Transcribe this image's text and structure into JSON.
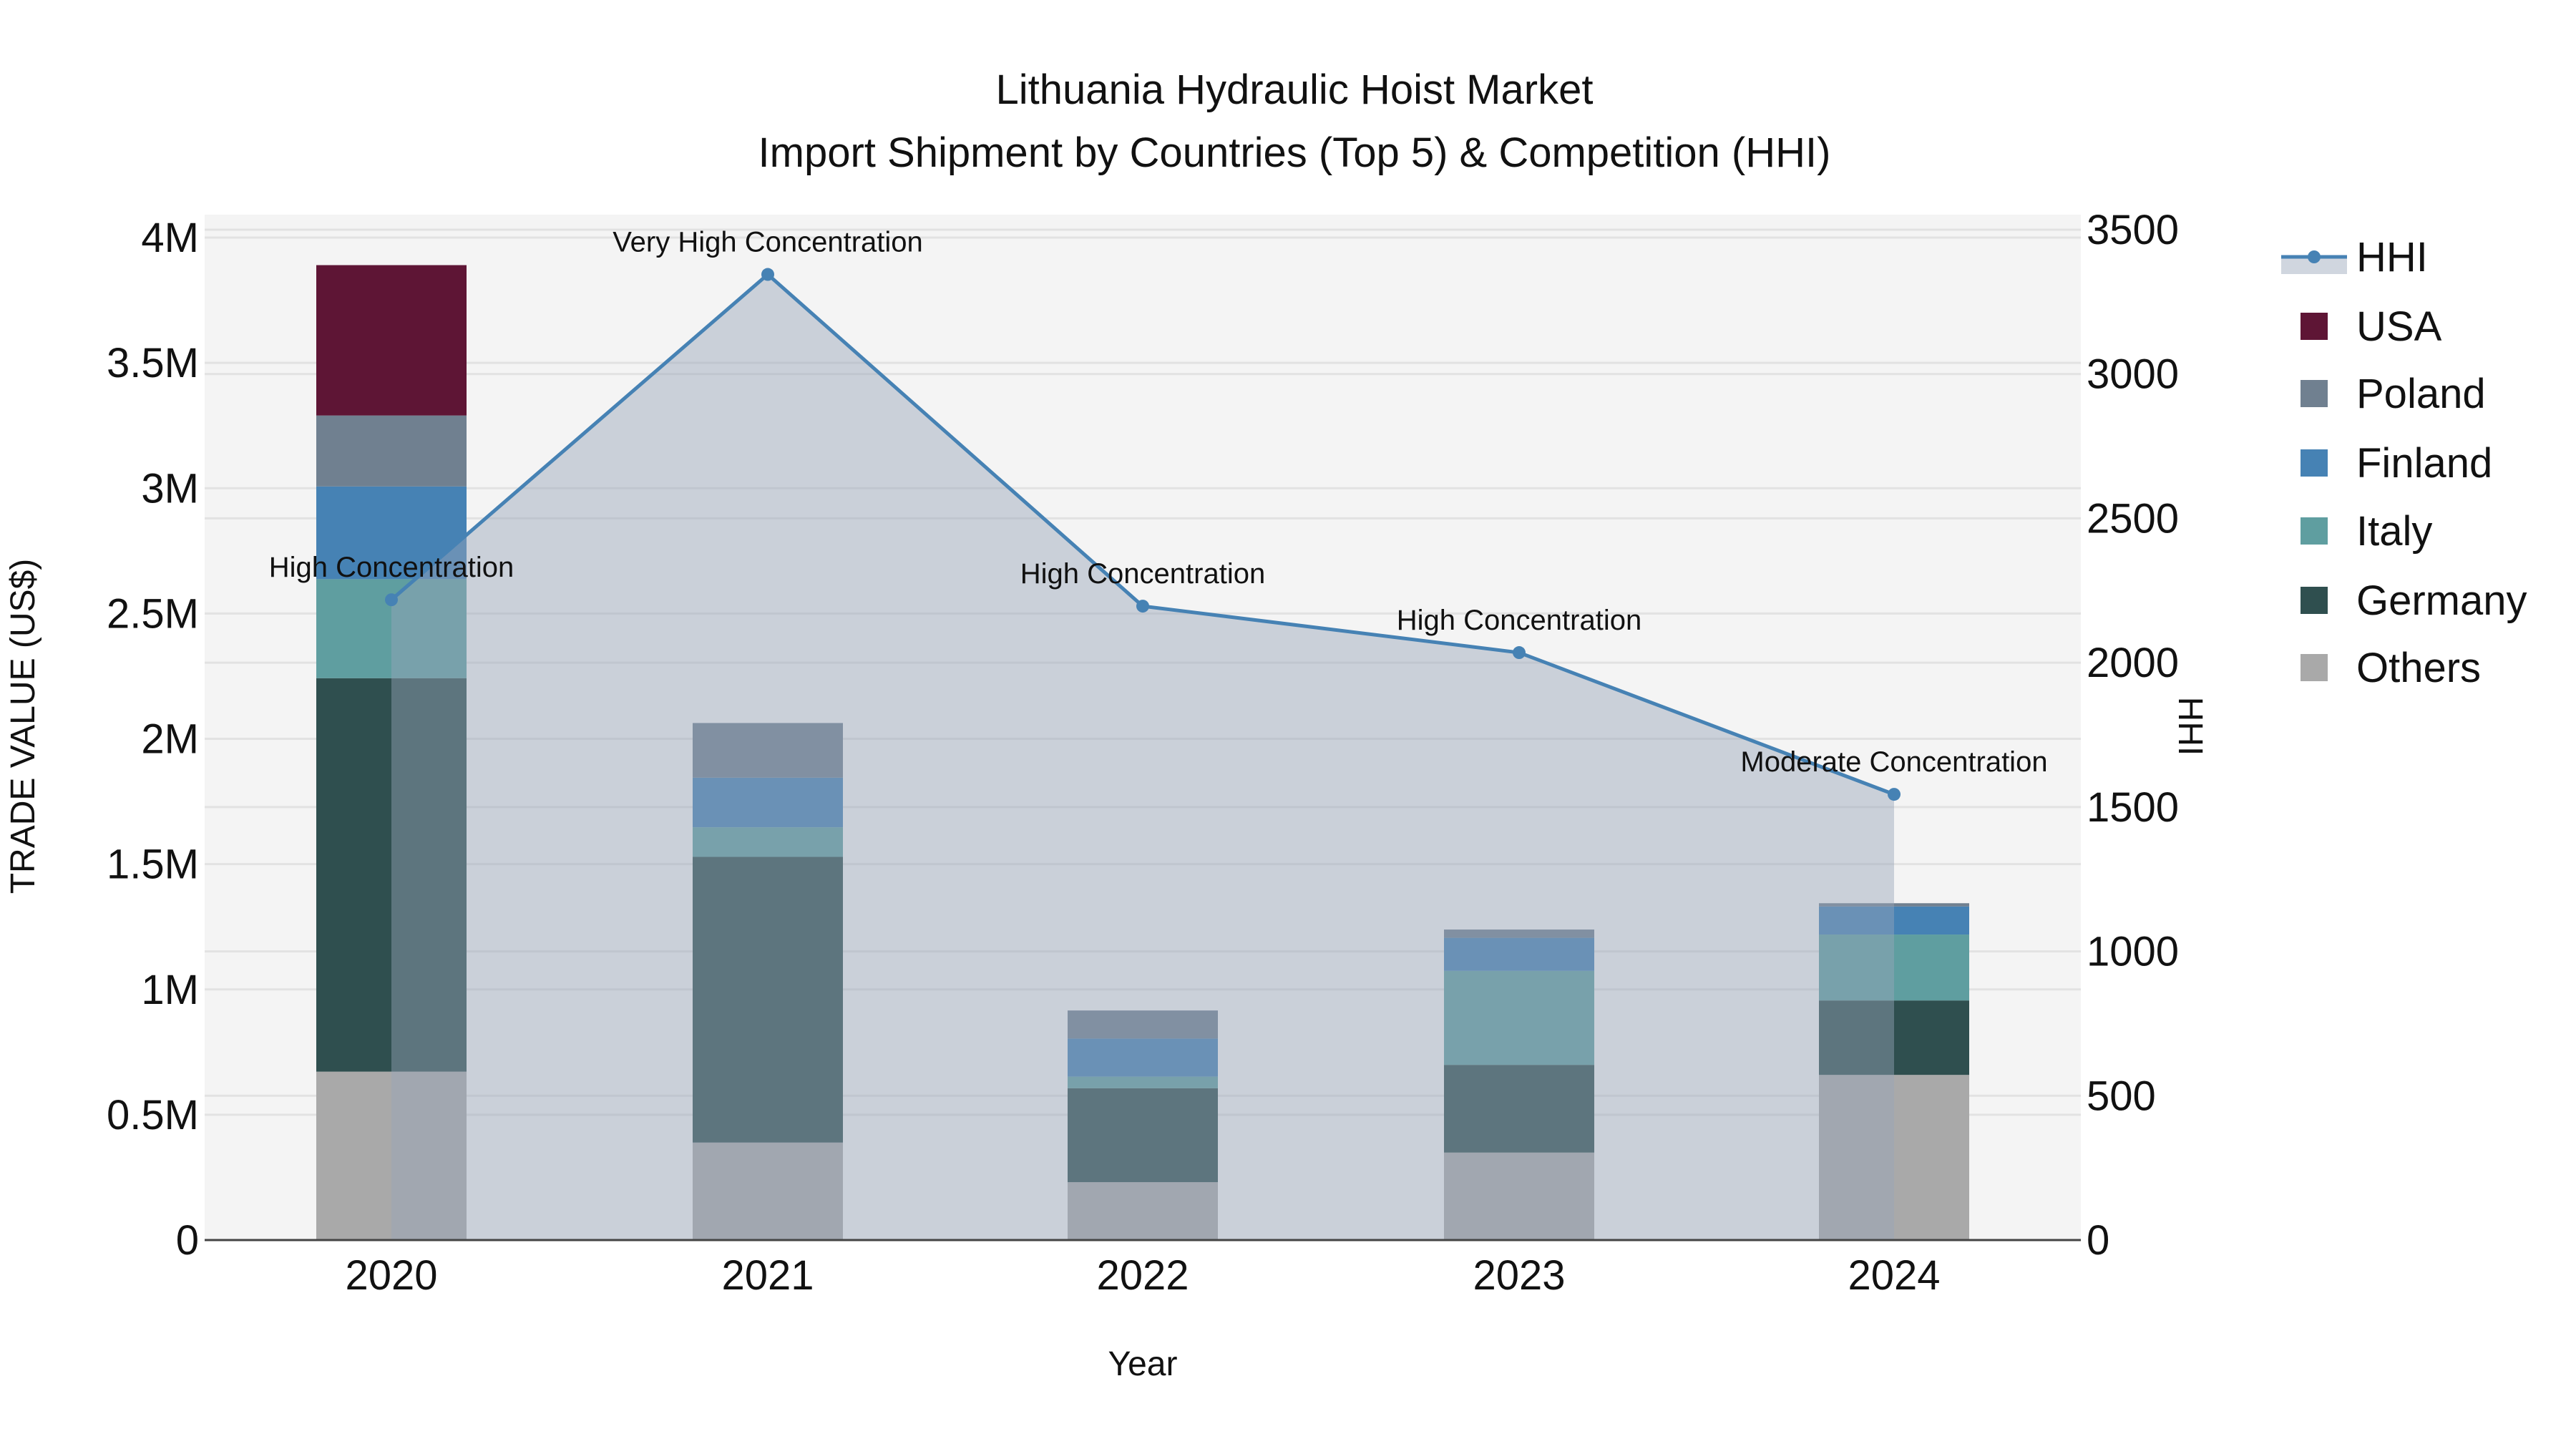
{
  "chart_data": {
    "type": "bar",
    "title": "Lithuania Hydraulic Hoist Market",
    "subtitle": "Import Shipment by Countries (Top 5) & Competition (HHI)",
    "xlabel": "Year",
    "ylabel": "TRADE VALUE (US$)",
    "y2label": "HHI",
    "categories": [
      "2020",
      "2021",
      "2022",
      "2023",
      "2024"
    ],
    "ylim": [
      0,
      4000000
    ],
    "y2lim": [
      0,
      3500
    ],
    "y_ticks": [
      {
        "value": 0,
        "label": "0"
      },
      {
        "value": 500000,
        "label": "0.5M"
      },
      {
        "value": 1000000,
        "label": "1M"
      },
      {
        "value": 1500000,
        "label": "1.5M"
      },
      {
        "value": 2000000,
        "label": "2M"
      },
      {
        "value": 2500000,
        "label": "2.5M"
      },
      {
        "value": 3000000,
        "label": "3M"
      },
      {
        "value": 3500000,
        "label": "3.5M"
      },
      {
        "value": 4000000,
        "label": "4M"
      }
    ],
    "y2_ticks": [
      {
        "value": 0,
        "label": "0"
      },
      {
        "value": 500,
        "label": "500"
      },
      {
        "value": 1000,
        "label": "1000"
      },
      {
        "value": 1500,
        "label": "1500"
      },
      {
        "value": 2000,
        "label": "2000"
      },
      {
        "value": 2500,
        "label": "2500"
      },
      {
        "value": 3000,
        "label": "3000"
      },
      {
        "value": 3500,
        "label": "3500"
      }
    ],
    "stacked": true,
    "series": [
      {
        "name": "Others",
        "color": "#A9A9A9",
        "values": [
          672000,
          389000,
          231000,
          349000,
          659000
        ]
      },
      {
        "name": "Germany",
        "color": "#2F4F4F",
        "values": [
          1570000,
          1140000,
          375000,
          350000,
          297000
        ]
      },
      {
        "name": "Italy",
        "color": "#5F9EA0",
        "values": [
          395000,
          118000,
          46000,
          375000,
          263000
        ]
      },
      {
        "name": "Finland",
        "color": "#4682B4",
        "values": [
          370000,
          198000,
          152000,
          132000,
          112000
        ]
      },
      {
        "name": "Poland",
        "color": "#708090",
        "values": [
          283000,
          218000,
          112000,
          33000,
          13000
        ]
      },
      {
        "name": "USA",
        "color": "#5E1535",
        "values": [
          600000,
          0,
          0,
          0,
          0
        ]
      }
    ],
    "line": {
      "name": "HHI",
      "color": "#4682B4",
      "axis": "y2",
      "values": [
        2218,
        3345,
        2196,
        2035,
        1544
      ],
      "annotations": [
        "High Concentration",
        "Very High Concentration",
        "High Concentration",
        "High Concentration",
        "Moderate Concentration"
      ]
    },
    "legend": {
      "placement": "right",
      "items": [
        "HHI",
        "USA",
        "Poland",
        "Finland",
        "Italy",
        "Germany",
        "Others"
      ]
    },
    "grid": true
  }
}
